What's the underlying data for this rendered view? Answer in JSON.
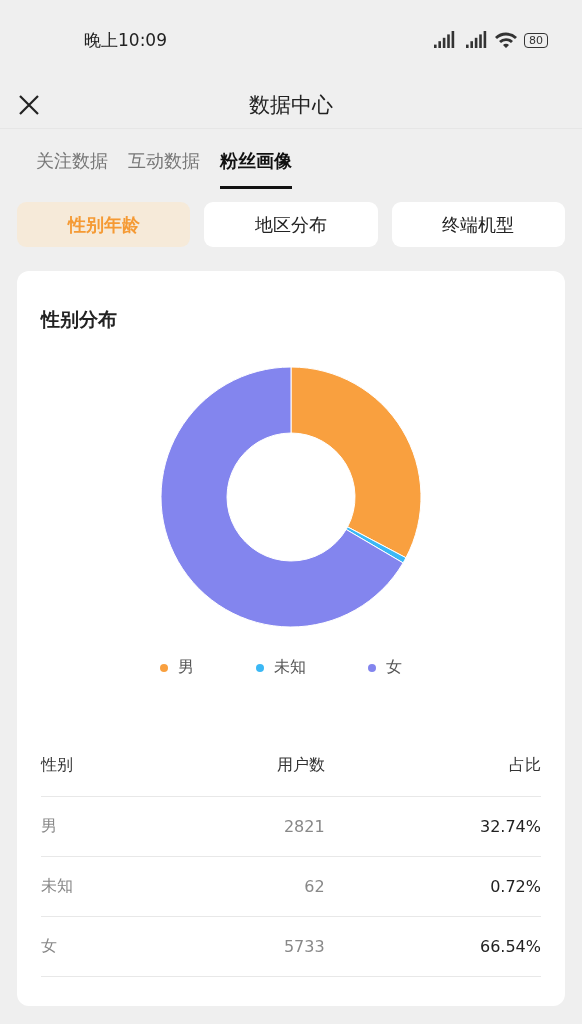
{
  "status_bar": {
    "time": "晚上10:09",
    "battery": "80"
  },
  "header": {
    "title": "数据中心"
  },
  "tabs": [
    {
      "label": "关注数据",
      "selected": false
    },
    {
      "label": "互动数据",
      "selected": false
    },
    {
      "label": "粉丝画像",
      "selected": true
    }
  ],
  "segments": [
    {
      "label": "性别年龄",
      "selected": true
    },
    {
      "label": "地区分布",
      "selected": false
    },
    {
      "label": "终端机型",
      "selected": false
    }
  ],
  "card": {
    "title": "性别分布",
    "chart_data": {
      "type": "donut",
      "categories": [
        "男",
        "未知",
        "女"
      ],
      "values": [
        32.74,
        0.72,
        66.54
      ],
      "colors": [
        "#f9a03f",
        "#3bb8f5",
        "#8385ee"
      ]
    },
    "table": {
      "columns": [
        "性别",
        "用户数",
        "占比"
      ],
      "rows": [
        [
          "男",
          "2821",
          "32.74%"
        ],
        [
          "未知",
          "62",
          "0.72%"
        ],
        [
          "女",
          "5733",
          "66.54%"
        ]
      ]
    }
  }
}
